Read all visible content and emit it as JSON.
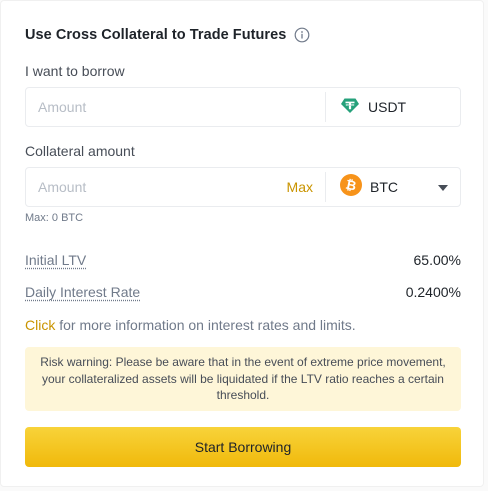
{
  "header": {
    "title": "Use Cross Collateral to Trade Futures",
    "info_icon": "info-icon"
  },
  "borrow": {
    "label": "I want to borrow",
    "placeholder": "Amount",
    "value": "",
    "coin": "USDT",
    "coin_icon": "tether-icon",
    "coin_color": "#26a17b"
  },
  "collateral": {
    "label": "Collateral amount",
    "placeholder": "Amount",
    "value": "",
    "max_label": "Max",
    "coin": "BTC",
    "coin_icon": "bitcoin-icon",
    "coin_color": "#f7931a",
    "hint": "Max: 0 BTC"
  },
  "stats": {
    "initial_ltv_label": "Initial LTV",
    "initial_ltv_value": "65.00%",
    "daily_rate_label": "Daily Interest Rate",
    "daily_rate_value": "0.2400%"
  },
  "more_info": {
    "link": "Click",
    "text": "for more information on interest rates and limits."
  },
  "warning": {
    "text": "Risk warning: Please be aware that in the event of extreme price movement, your collateralized assets will be liquidated if the LTV ratio reaches a certain threshold."
  },
  "action": {
    "start_label": "Start Borrowing"
  },
  "colors": {
    "accent": "#f0b90b",
    "link": "#c99400",
    "warning_bg": "#fef6d8"
  }
}
